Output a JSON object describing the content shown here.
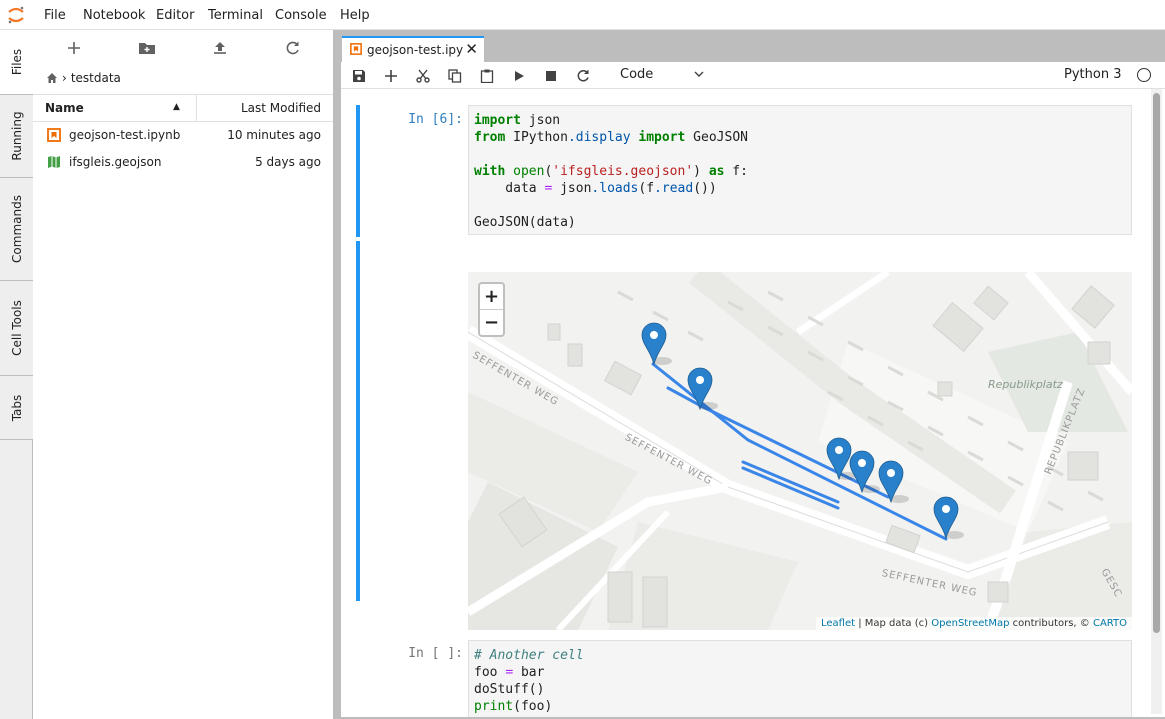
{
  "menu": [
    "File",
    "Notebook",
    "Editor",
    "Terminal",
    "Console",
    "Help"
  ],
  "sidetabs": [
    "Files",
    "Running",
    "Commands",
    "Cell Tools",
    "Tabs"
  ],
  "filebrowser": {
    "breadcrumb": "testdata",
    "header_name": "Name",
    "header_modified": "Last Modified",
    "files": [
      {
        "name": "geojson-test.ipynb",
        "modified": "10 minutes ago",
        "icon": "notebook-icon"
      },
      {
        "name": "ifsgleis.geojson",
        "modified": "5 days ago",
        "icon": "map-file-icon"
      }
    ]
  },
  "tab": {
    "label": "geojson-test.ipynb"
  },
  "toolbar": {
    "cell_type": "Code",
    "kernel": "Python 3"
  },
  "cells": [
    {
      "prompt": "In [6]:"
    },
    {
      "prompt": "In [ ]:"
    }
  ],
  "map": {
    "zoom_in": "+",
    "zoom_out": "−",
    "labels": {
      "square": "Republikplatz",
      "street_a": "SEFFENTER WEG",
      "street_b": "SEFFENTER WEG",
      "street_c": "SEFFENTER WEG",
      "street_d": "REPUBLIKPLATZ",
      "street_e": "GESC"
    },
    "attribution": {
      "leaflet": "Leaflet",
      "text1": " | Map data (c) ",
      "osm": "OpenStreetMap",
      "text2": " contributors, © ",
      "carto": "CARTO"
    },
    "line_color": "#3a86e8",
    "marker_color": "#2a81cb"
  },
  "colors": {
    "accent": "#2196f3",
    "prompt": "#307fc1"
  }
}
